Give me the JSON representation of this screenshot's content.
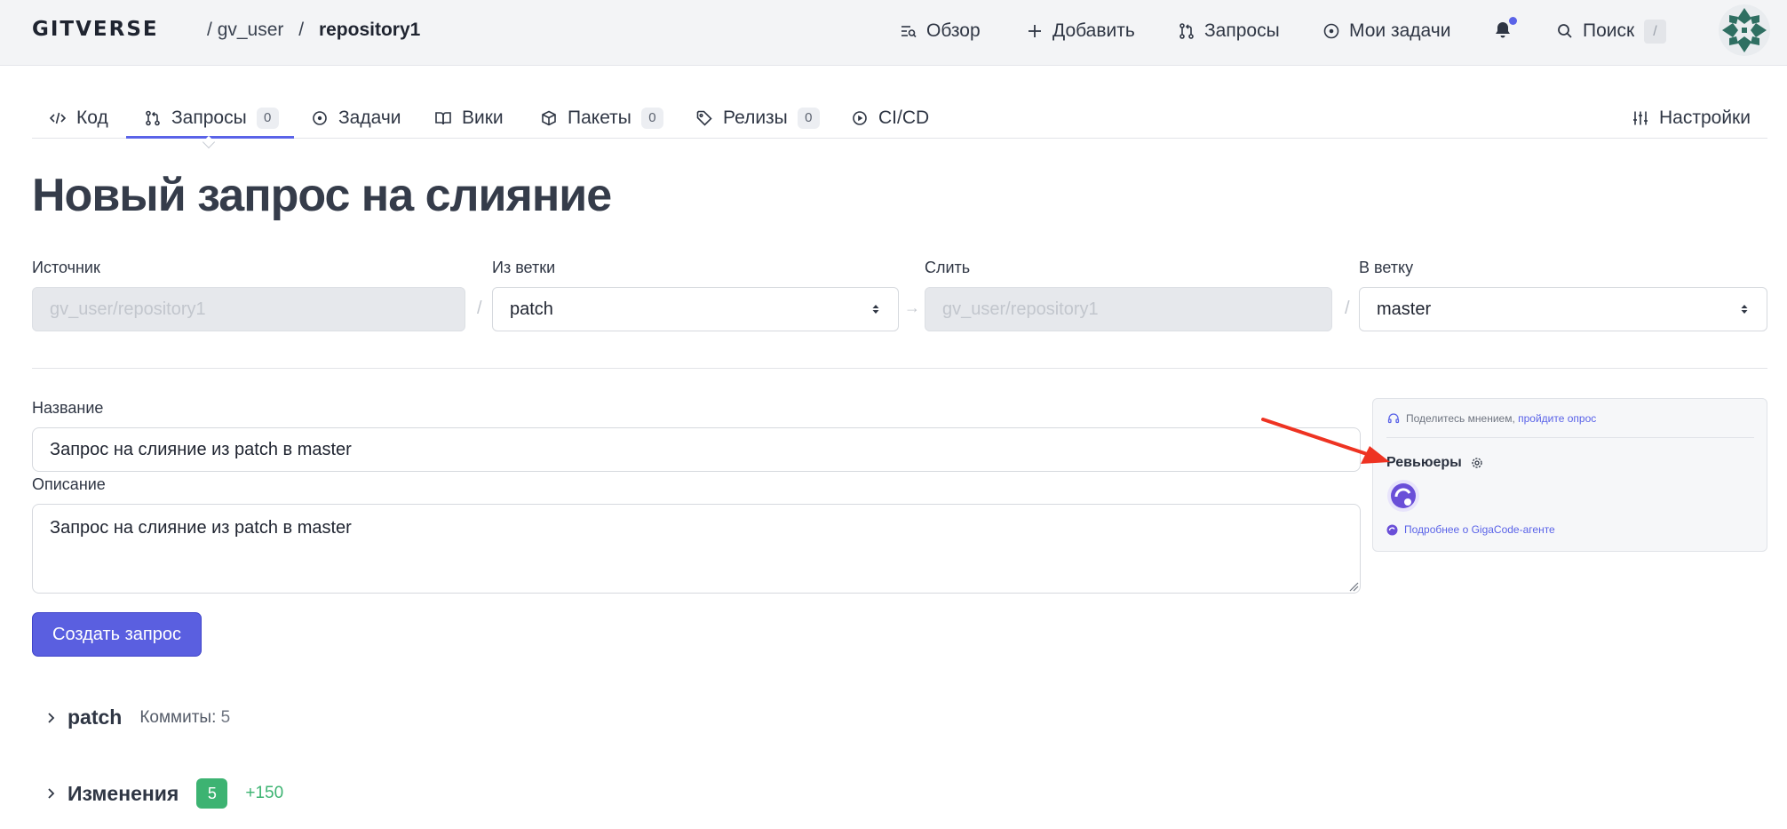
{
  "header": {
    "logo": "GITVERSE",
    "breadcrumb": {
      "user": "gv_user",
      "repo": "repository1",
      "separator": "/"
    },
    "nav": [
      {
        "label": "Обзор",
        "icon": "overview-icon"
      },
      {
        "label": "Добавить",
        "icon": "plus-icon"
      },
      {
        "label": "Запросы",
        "icon": "pull-request-icon"
      },
      {
        "label": "Мои задачи",
        "icon": "issue-circle-icon"
      }
    ],
    "search_label": "Поиск",
    "search_shortcut": "/"
  },
  "tabs": [
    {
      "label": "Код",
      "icon": "code-icon"
    },
    {
      "label": "Запросы",
      "icon": "pull-request-icon",
      "count": "0",
      "active": true
    },
    {
      "label": "Задачи",
      "icon": "issue-circle-icon"
    },
    {
      "label": "Вики",
      "icon": "book-icon"
    },
    {
      "label": "Пакеты",
      "icon": "package-icon",
      "count": "0"
    },
    {
      "label": "Релизы",
      "icon": "tag-icon",
      "count": "0"
    },
    {
      "label": "CI/CD",
      "icon": "play-circle-icon"
    }
  ],
  "settings_tab": "Настройки",
  "page_title": "Новый запрос на слияние",
  "merge": {
    "source_label": "Источник",
    "source_value": "gv_user/repository1",
    "from_branch_label": "Из ветки",
    "from_branch_value": "patch",
    "target_label": "Слить",
    "target_value": "gv_user/repository1",
    "to_branch_label": "В ветку",
    "to_branch_value": "master",
    "slash": "/",
    "arrow": "→"
  },
  "form": {
    "title_label": "Название",
    "title_value": "Запрос на слияние из patch в master",
    "description_label": "Описание",
    "description_value": "Запрос на слияние из patch в master",
    "submit_label": "Создать запрос"
  },
  "side_panel": {
    "poll_text": "Поделитесь мнением,",
    "poll_link": "пройдите опрос",
    "reviewers_label": "Ревьюеры",
    "gigacode_link": "Подробнее о GigaCode-агенте"
  },
  "sections": {
    "branch_name": "patch",
    "commits_label": "Коммиты:",
    "commits_count": "5",
    "changes_label": "Изменения",
    "changes_files": "5",
    "changes_added": "+150"
  },
  "colors": {
    "accent": "#5a63e8",
    "button": "#5a5fe0",
    "success": "#3db372",
    "annotation_arrow": "#ee3322"
  }
}
